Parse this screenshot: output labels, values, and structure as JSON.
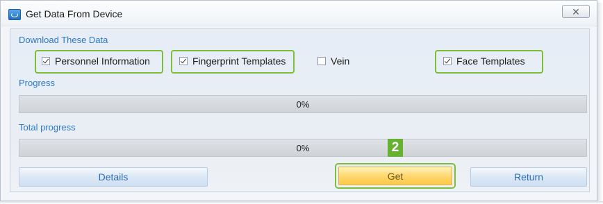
{
  "window": {
    "title": "Get Data From Device",
    "close_glyph": "✕"
  },
  "download_section": {
    "label": "Download These Data",
    "options": [
      {
        "label": "Personnel Information",
        "checked": true,
        "highlighted": true
      },
      {
        "label": "Fingerprint Templates",
        "checked": true,
        "highlighted": true
      },
      {
        "label": "Vein",
        "checked": false,
        "highlighted": false
      },
      {
        "label": "Face Templates",
        "checked": true,
        "highlighted": true
      }
    ]
  },
  "progress": {
    "label": "Progress",
    "value_text": "0%",
    "value": 0
  },
  "total_progress": {
    "label": "Total progress",
    "value_text": "0%",
    "value": 0
  },
  "buttons": {
    "details": "Details",
    "get": "Get",
    "return": "Return"
  },
  "step_badge": "2",
  "colors": {
    "highlight_outline": "#7cbd3c",
    "label_blue": "#2e78c8",
    "get_button": "#ffd56a"
  }
}
